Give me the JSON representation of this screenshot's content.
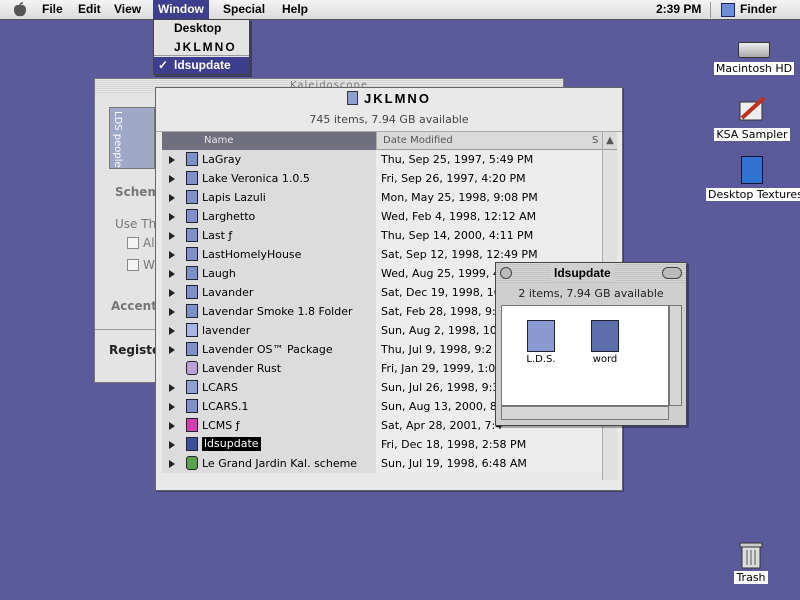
{
  "menubar": {
    "items": [
      "File",
      "Edit",
      "View",
      "Window",
      "Special",
      "Help"
    ],
    "active": "Window",
    "clock": "2:39 PM",
    "app": "Finder"
  },
  "window_menu": {
    "items": [
      "Desktop",
      "JKLMNO",
      "ldsupdate"
    ],
    "checked": "ldsupdate"
  },
  "kaleidoscope_window": {
    "title": "Kaleidoscope",
    "tab_label": "LDS people",
    "tab_scheme": "Schem",
    "use_label": "Use Th",
    "check1": "Al",
    "check2": "W",
    "accent": "Accent",
    "register": "Register"
  },
  "list_window": {
    "title": "JKLMNO",
    "info": "745 items, 7.94 GB available",
    "col_name": "Name",
    "col_date": "Date Modified",
    "col_size": "S",
    "rows": [
      {
        "name": "LaGray",
        "date": "Thu, Sep 25, 1997, 5:49 PM",
        "icon": "folder",
        "color": "#7f8fc8",
        "tri": true
      },
      {
        "name": "Lake Veronica 1.0.5",
        "date": "Fri, Sep 26, 1997, 4:20 PM",
        "icon": "folder",
        "color": "#7f8fc8",
        "tri": true
      },
      {
        "name": "Lapis Lazuli",
        "date": "Mon, May 25, 1998, 9:08 PM",
        "icon": "folder",
        "color": "#7f8fc8",
        "tri": true
      },
      {
        "name": "Larghetto",
        "date": "Wed, Feb 4, 1998, 12:12 AM",
        "icon": "folder",
        "color": "#7f8fc8",
        "tri": true
      },
      {
        "name": "Last ƒ",
        "date": "Thu, Sep 14, 2000, 4:11 PM",
        "icon": "folder",
        "color": "#7f8fc8",
        "tri": true
      },
      {
        "name": "LastHomelyHouse",
        "date": "Sat, Sep 12, 1998, 12:49 PM",
        "icon": "folder",
        "color": "#7f8fc8",
        "tri": true
      },
      {
        "name": "Laugh",
        "date": "Wed, Aug 25, 1999, 4",
        "icon": "folder",
        "color": "#7f8fc8",
        "tri": true
      },
      {
        "name": "Lavander",
        "date": "Sat, Dec 19, 1998, 10",
        "icon": "folder",
        "color": "#7f8fc8",
        "tri": true
      },
      {
        "name": "Lavendar Smoke 1.8 Folder",
        "date": "Sat, Feb 28, 1998, 9:5",
        "icon": "folder",
        "color": "#7f8fc8",
        "tri": true
      },
      {
        "name": "lavender",
        "date": "Sun, Aug 2, 1998, 10:",
        "icon": "folder",
        "color": "#a7b5e0",
        "tri": true
      },
      {
        "name": "Lavender OS™ Package",
        "date": "Thu, Jul 9, 1998, 9:2",
        "icon": "folder",
        "color": "#7f8fc8",
        "tri": true
      },
      {
        "name": "Lavender Rust",
        "date": "Fri, Jan 29, 1999, 1:0",
        "icon": "file",
        "color": "#b9a3d6",
        "tri": false
      },
      {
        "name": "LCARS",
        "date": "Sun, Jul 26, 1998, 9:3",
        "icon": "folder",
        "color": "#8f9fcf",
        "tri": true
      },
      {
        "name": "LCARS.1",
        "date": "Sun, Aug 13, 2000, 8:5",
        "icon": "folder",
        "color": "#7f8fc8",
        "tri": true
      },
      {
        "name": "LCMS ƒ",
        "date": "Sat, Apr 28, 2001, 7:4",
        "icon": "folder",
        "color": "#d63fb0",
        "tri": true
      },
      {
        "name": "ldsupdate",
        "date": "Fri, Dec 18, 1998, 2:58 PM",
        "icon": "folder",
        "color": "#3d4f9a",
        "tri": true,
        "selected": true
      },
      {
        "name": "Le Grand Jardin Kal. scheme",
        "date": "Sun, Jul 19, 1998, 6:48 AM",
        "icon": "file",
        "color": "#5aa04a",
        "tri": true
      }
    ]
  },
  "ldsupdate_window": {
    "title": "ldsupdate",
    "info": "2 items, 7.94 GB available",
    "items": [
      "L.D.S.",
      "word"
    ]
  },
  "desktop": {
    "icons": [
      "Macintosh HD",
      "KSA Sampler",
      "Desktop Textures",
      "Trash"
    ]
  },
  "colors": {
    "desktop": "#5b5b9c",
    "highlight": "#3e3e8e"
  }
}
